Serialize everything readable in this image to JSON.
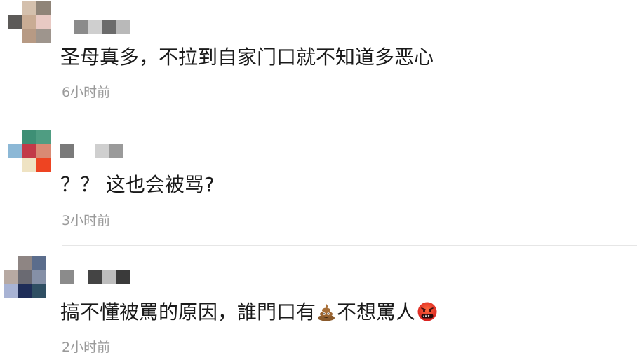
{
  "comments": [
    {
      "text": "圣母真多，不拉到自家门口就不知道多恶心",
      "time": "6小时前"
    },
    {
      "text": "？？ 这也会被骂?",
      "time": "3小时前"
    },
    {
      "text_before": "搞不懂被罵的原因，誰門口有",
      "text_middle": "不想罵人",
      "time": "2小时前",
      "emoji_1": "pile-of-poo-icon",
      "emoji_2": "face-with-symbols-on-mouth-icon"
    }
  ],
  "colors": {
    "text": "#1a1a1a",
    "time": "#9a9a9a",
    "divider": "#e6e6e6"
  }
}
